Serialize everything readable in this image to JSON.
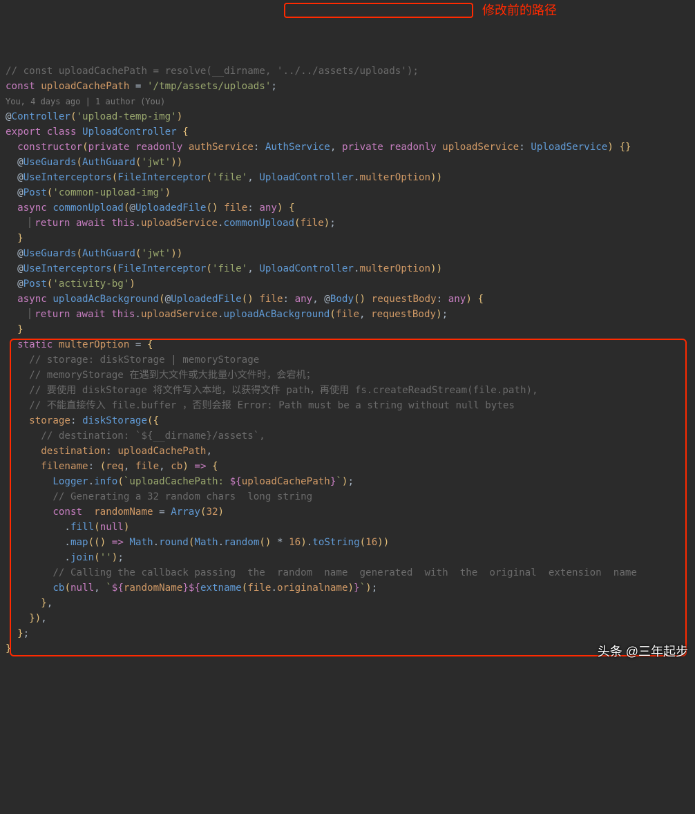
{
  "annotations": {
    "red_label": "修改前的路径",
    "watermark": "头条 @三年起步"
  },
  "code_lens": "You, 4 days ago | 1 author (You)",
  "code_lines": [
    [
      [
        "c-cmt",
        "// "
      ],
      [
        "c-cmt",
        "const uploadCachePath = resolve(__dirname, "
      ],
      [
        "c-cmt",
        "'../../assets/uploads');"
      ]
    ],
    [
      [
        "c-kw",
        "const "
      ],
      [
        "c-or",
        "uploadCachePath"
      ],
      [
        "c-def",
        " = "
      ],
      [
        "c-str",
        "'/tmp/assets/uploads'"
      ],
      [
        "c-def",
        ";"
      ]
    ],
    [
      [
        "c-def",
        ""
      ]
    ],
    [
      [
        "c-lens",
        "__CODELENS__"
      ]
    ],
    [
      [
        "c-def",
        "@"
      ],
      [
        "c-blue",
        "Controller"
      ],
      [
        "c-brc",
        "("
      ],
      [
        "c-str",
        "'upload-temp-img'"
      ],
      [
        "c-brc",
        ")"
      ]
    ],
    [
      [
        "c-kw",
        "export "
      ],
      [
        "c-kw",
        "class "
      ],
      [
        "c-blue",
        "UploadController"
      ],
      [
        "c-def",
        " "
      ],
      [
        "c-brc",
        "{"
      ]
    ],
    [
      [
        "c-def",
        "  "
      ],
      [
        "c-kw",
        "constructor"
      ],
      [
        "c-brc",
        "("
      ],
      [
        "c-kw",
        "private "
      ],
      [
        "c-kw",
        "readonly "
      ],
      [
        "c-or",
        "authService"
      ],
      [
        "c-def",
        ": "
      ],
      [
        "c-blue",
        "AuthService"
      ],
      [
        "c-def",
        ", "
      ],
      [
        "c-kw",
        "private "
      ],
      [
        "c-kw",
        "readonly "
      ],
      [
        "c-or",
        "uploadService"
      ],
      [
        "c-def",
        ": "
      ],
      [
        "c-blue",
        "UploadService"
      ],
      [
        "c-brc",
        ")"
      ],
      [
        "c-def",
        " "
      ],
      [
        "c-brc",
        "{}"
      ]
    ],
    [
      [
        "c-def",
        ""
      ]
    ],
    [
      [
        "c-def",
        "  @"
      ],
      [
        "c-blue",
        "UseGuards"
      ],
      [
        "c-brc",
        "("
      ],
      [
        "c-blue",
        "AuthGuard"
      ],
      [
        "c-brc",
        "("
      ],
      [
        "c-str",
        "'jwt'"
      ],
      [
        "c-brc",
        "))"
      ]
    ],
    [
      [
        "c-def",
        "  @"
      ],
      [
        "c-blue",
        "UseInterceptors"
      ],
      [
        "c-brc",
        "("
      ],
      [
        "c-blue",
        "FileInterceptor"
      ],
      [
        "c-brc",
        "("
      ],
      [
        "c-str",
        "'file'"
      ],
      [
        "c-def",
        ", "
      ],
      [
        "c-blue",
        "UploadController"
      ],
      [
        "c-def",
        "."
      ],
      [
        "c-or",
        "multerOption"
      ],
      [
        "c-brc",
        "))"
      ]
    ],
    [
      [
        "c-def",
        "  @"
      ],
      [
        "c-blue",
        "Post"
      ],
      [
        "c-brc",
        "("
      ],
      [
        "c-str",
        "'common-upload-img'"
      ],
      [
        "c-brc",
        ")"
      ]
    ],
    [
      [
        "c-def",
        "  "
      ],
      [
        "c-kw",
        "async "
      ],
      [
        "c-blue",
        "commonUpload"
      ],
      [
        "c-brc",
        "("
      ],
      [
        "c-def",
        "@"
      ],
      [
        "c-blue",
        "UploadedFile"
      ],
      [
        "c-brc",
        "()"
      ],
      [
        "c-def",
        " "
      ],
      [
        "c-or",
        "file"
      ],
      [
        "c-def",
        ": "
      ],
      [
        "c-kw",
        "any"
      ],
      [
        "c-brc",
        ")"
      ],
      [
        "c-def",
        " "
      ],
      [
        "c-brc",
        "{"
      ]
    ],
    [
      [
        "c-def",
        "    "
      ],
      [
        "bar",
        ""
      ],
      [
        "c-kw",
        "return "
      ],
      [
        "c-kw",
        "await "
      ],
      [
        "c-kw",
        "this"
      ],
      [
        "c-def",
        "."
      ],
      [
        "c-or",
        "uploadService"
      ],
      [
        "c-def",
        "."
      ],
      [
        "c-blue",
        "commonUpload"
      ],
      [
        "c-brc",
        "("
      ],
      [
        "c-or",
        "file"
      ],
      [
        "c-brc",
        ")"
      ],
      [
        "c-def",
        ";"
      ]
    ],
    [
      [
        "c-def",
        "  "
      ],
      [
        "c-brc",
        "}"
      ]
    ],
    [
      [
        "c-def",
        ""
      ]
    ],
    [
      [
        "c-def",
        "  @"
      ],
      [
        "c-blue",
        "UseGuards"
      ],
      [
        "c-brc",
        "("
      ],
      [
        "c-blue",
        "AuthGuard"
      ],
      [
        "c-brc",
        "("
      ],
      [
        "c-str",
        "'jwt'"
      ],
      [
        "c-brc",
        "))"
      ]
    ],
    [
      [
        "c-def",
        "  @"
      ],
      [
        "c-blue",
        "UseInterceptors"
      ],
      [
        "c-brc",
        "("
      ],
      [
        "c-blue",
        "FileInterceptor"
      ],
      [
        "c-brc",
        "("
      ],
      [
        "c-str",
        "'file'"
      ],
      [
        "c-def",
        ", "
      ],
      [
        "c-blue",
        "UploadController"
      ],
      [
        "c-def",
        "."
      ],
      [
        "c-or",
        "multerOption"
      ],
      [
        "c-brc",
        "))"
      ]
    ],
    [
      [
        "c-def",
        "  @"
      ],
      [
        "c-blue",
        "Post"
      ],
      [
        "c-brc",
        "("
      ],
      [
        "c-str",
        "'activity-bg'"
      ],
      [
        "c-brc",
        ")"
      ]
    ],
    [
      [
        "c-def",
        "  "
      ],
      [
        "c-kw",
        "async "
      ],
      [
        "c-blue",
        "uploadAcBackground"
      ],
      [
        "c-brc",
        "("
      ],
      [
        "c-def",
        "@"
      ],
      [
        "c-blue",
        "UploadedFile"
      ],
      [
        "c-brc",
        "()"
      ],
      [
        "c-def",
        " "
      ],
      [
        "c-or",
        "file"
      ],
      [
        "c-def",
        ": "
      ],
      [
        "c-kw",
        "any"
      ],
      [
        "c-def",
        ", @"
      ],
      [
        "c-blue",
        "Body"
      ],
      [
        "c-brc",
        "()"
      ],
      [
        "c-def",
        " "
      ],
      [
        "c-or",
        "requestBody"
      ],
      [
        "c-def",
        ": "
      ],
      [
        "c-kw",
        "any"
      ],
      [
        "c-brc",
        ")"
      ],
      [
        "c-def",
        " "
      ],
      [
        "c-brc",
        "{"
      ]
    ],
    [
      [
        "c-def",
        "    "
      ],
      [
        "bar",
        ""
      ],
      [
        "c-kw",
        "return "
      ],
      [
        "c-kw",
        "await "
      ],
      [
        "c-kw",
        "this"
      ],
      [
        "c-def",
        "."
      ],
      [
        "c-or",
        "uploadService"
      ],
      [
        "c-def",
        "."
      ],
      [
        "c-blue",
        "uploadAcBackground"
      ],
      [
        "c-brc",
        "("
      ],
      [
        "c-or",
        "file"
      ],
      [
        "c-def",
        ", "
      ],
      [
        "c-or",
        "requestBody"
      ],
      [
        "c-brc",
        ")"
      ],
      [
        "c-def",
        ";"
      ]
    ],
    [
      [
        "c-def",
        "  "
      ],
      [
        "c-brc",
        "}"
      ]
    ],
    [
      [
        "c-def",
        ""
      ]
    ],
    [
      [
        "c-def",
        "  "
      ],
      [
        "c-kw",
        "static "
      ],
      [
        "c-or",
        "multerOption"
      ],
      [
        "c-def",
        " = "
      ],
      [
        "c-brc",
        "{"
      ]
    ],
    [
      [
        "c-def",
        "    "
      ],
      [
        "c-cmt",
        "// storage: diskStorage | memoryStorage"
      ]
    ],
    [
      [
        "c-def",
        "    "
      ],
      [
        "c-cmt",
        "// memoryStorage 在遇到大文件或大批量小文件时，会宕机；"
      ]
    ],
    [
      [
        "c-def",
        "    "
      ],
      [
        "c-cmt",
        "// 要使用 diskStorage 将文件写入本地，以获得文件 path，再使用 fs.createReadStream(file.path),"
      ]
    ],
    [
      [
        "c-def",
        "    "
      ],
      [
        "c-cmt",
        "// 不能直接传入 file.buffer ，否则会报 Error: Path must be a string without null bytes"
      ]
    ],
    [
      [
        "c-def",
        "    "
      ],
      [
        "c-or",
        "storage"
      ],
      [
        "c-def",
        ": "
      ],
      [
        "c-blue",
        "diskStorage"
      ],
      [
        "c-brc",
        "({"
      ]
    ],
    [
      [
        "c-def",
        "      "
      ],
      [
        "c-cmt",
        "// destination: `${__dirname}/assets`,"
      ]
    ],
    [
      [
        "c-def",
        "      "
      ],
      [
        "c-or",
        "destination"
      ],
      [
        "c-def",
        ": "
      ],
      [
        "c-or",
        "uploadCachePath"
      ],
      [
        "c-def",
        ","
      ]
    ],
    [
      [
        "c-def",
        "      "
      ],
      [
        "c-or",
        "filename"
      ],
      [
        "c-def",
        ": "
      ],
      [
        "c-brc",
        "("
      ],
      [
        "c-or",
        "req"
      ],
      [
        "c-def",
        ", "
      ],
      [
        "c-or",
        "file"
      ],
      [
        "c-def",
        ", "
      ],
      [
        "c-or",
        "cb"
      ],
      [
        "c-brc",
        ")"
      ],
      [
        "c-def",
        " "
      ],
      [
        "c-kw",
        "=>"
      ],
      [
        "c-def",
        " "
      ],
      [
        "c-brc",
        "{"
      ]
    ],
    [
      [
        "c-def",
        "        "
      ],
      [
        "c-blue",
        "Logger"
      ],
      [
        "c-def",
        "."
      ],
      [
        "c-blue",
        "info"
      ],
      [
        "c-brc",
        "("
      ],
      [
        "c-str",
        "`uploadCachePath: "
      ],
      [
        "c-kw",
        "${"
      ],
      [
        "c-or",
        "uploadCachePath"
      ],
      [
        "c-kw",
        "}"
      ],
      [
        "c-str",
        "`"
      ],
      [
        "c-brc",
        ")"
      ],
      [
        "c-def",
        ";"
      ]
    ],
    [
      [
        "c-def",
        "        "
      ],
      [
        "c-cmt",
        "// Generating a 32 random chars  long string"
      ]
    ],
    [
      [
        "c-def",
        "        "
      ],
      [
        "c-kw",
        "const  "
      ],
      [
        "c-or",
        "randomName"
      ],
      [
        "c-def",
        " = "
      ],
      [
        "c-blue",
        "Array"
      ],
      [
        "c-brc",
        "("
      ],
      [
        "c-or",
        "32"
      ],
      [
        "c-brc",
        ")"
      ]
    ],
    [
      [
        "c-def",
        "          ."
      ],
      [
        "c-blue",
        "fill"
      ],
      [
        "c-brc",
        "("
      ],
      [
        "c-kw",
        "null"
      ],
      [
        "c-brc",
        ")"
      ]
    ],
    [
      [
        "c-def",
        "          ."
      ],
      [
        "c-blue",
        "map"
      ],
      [
        "c-brc",
        "(("
      ],
      [
        "c-brc",
        ")"
      ],
      [
        "c-def",
        " "
      ],
      [
        "c-kw",
        "=>"
      ],
      [
        "c-def",
        " "
      ],
      [
        "c-blue",
        "Math"
      ],
      [
        "c-def",
        "."
      ],
      [
        "c-blue",
        "round"
      ],
      [
        "c-brc",
        "("
      ],
      [
        "c-blue",
        "Math"
      ],
      [
        "c-def",
        "."
      ],
      [
        "c-blue",
        "random"
      ],
      [
        "c-brc",
        "()"
      ],
      [
        "c-def",
        " * "
      ],
      [
        "c-or",
        "16"
      ],
      [
        "c-brc",
        ")"
      ],
      [
        "c-def",
        "."
      ],
      [
        "c-blue",
        "toString"
      ],
      [
        "c-brc",
        "("
      ],
      [
        "c-or",
        "16"
      ],
      [
        "c-brc",
        "))"
      ]
    ],
    [
      [
        "c-def",
        "          ."
      ],
      [
        "c-blue",
        "join"
      ],
      [
        "c-brc",
        "("
      ],
      [
        "c-str",
        "''"
      ],
      [
        "c-brc",
        ")"
      ],
      [
        "c-def",
        ";"
      ]
    ],
    [
      [
        "c-def",
        "        "
      ],
      [
        "c-cmt",
        "// Calling the callback passing  the  random  name  generated  with  the  original  extension  name"
      ]
    ],
    [
      [
        "c-def",
        "        "
      ],
      [
        "c-blue",
        "cb"
      ],
      [
        "c-brc",
        "("
      ],
      [
        "c-kw",
        "null"
      ],
      [
        "c-def",
        ", "
      ],
      [
        "c-str",
        "`"
      ],
      [
        "c-kw",
        "${"
      ],
      [
        "c-or",
        "randomName"
      ],
      [
        "c-kw",
        "}${"
      ],
      [
        "c-blue",
        "extname"
      ],
      [
        "c-brc",
        "("
      ],
      [
        "c-or",
        "file"
      ],
      [
        "c-def",
        "."
      ],
      [
        "c-or",
        "originalname"
      ],
      [
        "c-brc",
        ")"
      ],
      [
        "c-kw",
        "}"
      ],
      [
        "c-str",
        "`"
      ],
      [
        "c-brc",
        ")"
      ],
      [
        "c-def",
        ";"
      ]
    ],
    [
      [
        "c-def",
        "      "
      ],
      [
        "c-brc",
        "}"
      ],
      [
        "c-def",
        ","
      ]
    ],
    [
      [
        "c-def",
        "    "
      ],
      [
        "c-brc",
        "})"
      ],
      [
        "c-def",
        ","
      ]
    ],
    [
      [
        "c-def",
        "  "
      ],
      [
        "c-brc",
        "}"
      ],
      [
        "c-def",
        ";"
      ]
    ],
    [
      [
        "c-brc",
        "}"
      ]
    ]
  ]
}
